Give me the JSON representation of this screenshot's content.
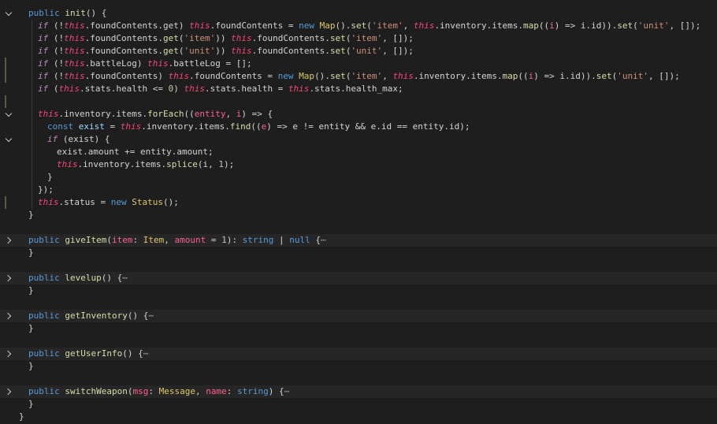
{
  "editor": {
    "lines": [
      {
        "indent": 0,
        "tokens": [
          [
            "kw",
            "public"
          ],
          [
            "op",
            " "
          ],
          [
            "fn",
            "init"
          ],
          [
            "op",
            "() {"
          ]
        ]
      },
      {
        "indent": 1,
        "tokens": [
          [
            "ctl",
            "if"
          ],
          [
            "op",
            " (!"
          ],
          [
            "th",
            "this"
          ],
          [
            "op",
            ".foundContents.get) "
          ],
          [
            "th",
            "this"
          ],
          [
            "op",
            ".foundContents = "
          ],
          [
            "kw",
            "new"
          ],
          [
            "op",
            " "
          ],
          [
            "cls",
            "Map"
          ],
          [
            "op",
            "()."
          ],
          [
            "fn",
            "set"
          ],
          [
            "op",
            "("
          ],
          [
            "str",
            "'item'"
          ],
          [
            "op",
            ", "
          ],
          [
            "th",
            "this"
          ],
          [
            "op",
            ".inventory.items."
          ],
          [
            "fn",
            "map"
          ],
          [
            "op",
            "(("
          ],
          [
            "prm",
            "i"
          ],
          [
            "op",
            ") => i.id))."
          ],
          [
            "fn",
            "set"
          ],
          [
            "op",
            "("
          ],
          [
            "str",
            "'unit'"
          ],
          [
            "op",
            ", []);"
          ]
        ]
      },
      {
        "indent": 1,
        "tokens": [
          [
            "ctl",
            "if"
          ],
          [
            "op",
            " (!"
          ],
          [
            "th",
            "this"
          ],
          [
            "op",
            ".foundContents."
          ],
          [
            "fn",
            "get"
          ],
          [
            "op",
            "("
          ],
          [
            "str",
            "'item'"
          ],
          [
            "op",
            ")) "
          ],
          [
            "th",
            "this"
          ],
          [
            "op",
            ".foundContents."
          ],
          [
            "fn",
            "set"
          ],
          [
            "op",
            "("
          ],
          [
            "str",
            "'item'"
          ],
          [
            "op",
            ", []);"
          ]
        ]
      },
      {
        "indent": 1,
        "tokens": [
          [
            "ctl",
            "if"
          ],
          [
            "op",
            " (!"
          ],
          [
            "th",
            "this"
          ],
          [
            "op",
            ".foundContents."
          ],
          [
            "fn",
            "get"
          ],
          [
            "op",
            "("
          ],
          [
            "str",
            "'unit'"
          ],
          [
            "op",
            ")) "
          ],
          [
            "th",
            "this"
          ],
          [
            "op",
            ".foundContents."
          ],
          [
            "fn",
            "set"
          ],
          [
            "op",
            "("
          ],
          [
            "str",
            "'unit'"
          ],
          [
            "op",
            ", []);"
          ]
        ]
      },
      {
        "indent": 1,
        "tokens": [
          [
            "ctl",
            "if"
          ],
          [
            "op",
            " (!"
          ],
          [
            "th",
            "this"
          ],
          [
            "op",
            ".battleLog) "
          ],
          [
            "th",
            "this"
          ],
          [
            "op",
            ".battleLog = [];"
          ]
        ]
      },
      {
        "indent": 1,
        "tokens": [
          [
            "ctl",
            "if"
          ],
          [
            "op",
            " (!"
          ],
          [
            "th",
            "this"
          ],
          [
            "op",
            ".foundContents) "
          ],
          [
            "th",
            "this"
          ],
          [
            "op",
            ".foundContents = "
          ],
          [
            "kw",
            "new"
          ],
          [
            "op",
            " "
          ],
          [
            "cls",
            "Map"
          ],
          [
            "op",
            "()."
          ],
          [
            "fn",
            "set"
          ],
          [
            "op",
            "("
          ],
          [
            "str",
            "'item'"
          ],
          [
            "op",
            ", "
          ],
          [
            "th",
            "this"
          ],
          [
            "op",
            ".inventory.items."
          ],
          [
            "fn",
            "map"
          ],
          [
            "op",
            "(("
          ],
          [
            "prm",
            "i"
          ],
          [
            "op",
            ") => i.id))."
          ],
          [
            "fn",
            "set"
          ],
          [
            "op",
            "("
          ],
          [
            "str",
            "'unit'"
          ],
          [
            "op",
            ", []);"
          ]
        ]
      },
      {
        "indent": 1,
        "tokens": [
          [
            "ctl",
            "if"
          ],
          [
            "op",
            " ("
          ],
          [
            "th",
            "this"
          ],
          [
            "op",
            ".stats.health <= "
          ],
          [
            "num",
            "0"
          ],
          [
            "op",
            ") "
          ],
          [
            "th",
            "this"
          ],
          [
            "op",
            ".stats.health = "
          ],
          [
            "th",
            "this"
          ],
          [
            "op",
            ".stats.health_max;"
          ]
        ]
      },
      {
        "indent": 1,
        "tokens": []
      },
      {
        "indent": 1,
        "tokens": [
          [
            "th",
            "this"
          ],
          [
            "op",
            ".inventory.items."
          ],
          [
            "fn",
            "forEach"
          ],
          [
            "op",
            "(("
          ],
          [
            "prm",
            "entity"
          ],
          [
            "op",
            ", "
          ],
          [
            "prm",
            "i"
          ],
          [
            "op",
            ") => {"
          ]
        ]
      },
      {
        "indent": 2,
        "tokens": [
          [
            "kw",
            "const"
          ],
          [
            "op",
            " "
          ],
          [
            "prop",
            "exist"
          ],
          [
            "op",
            " = "
          ],
          [
            "th",
            "this"
          ],
          [
            "op",
            ".inventory.items."
          ],
          [
            "fn",
            "find"
          ],
          [
            "op",
            "(("
          ],
          [
            "prm",
            "e"
          ],
          [
            "op",
            ") => e != entity && e.id == entity.id);"
          ]
        ]
      },
      {
        "indent": 2,
        "tokens": [
          [
            "ctl",
            "if"
          ],
          [
            "op",
            " (exist) {"
          ]
        ]
      },
      {
        "indent": 3,
        "tokens": [
          [
            "op",
            "exist.amount += entity.amount;"
          ]
        ]
      },
      {
        "indent": 3,
        "tokens": [
          [
            "th",
            "this"
          ],
          [
            "op",
            ".inventory.items."
          ],
          [
            "fn",
            "splice"
          ],
          [
            "op",
            "(i, "
          ],
          [
            "num",
            "1"
          ],
          [
            "op",
            ");"
          ]
        ]
      },
      {
        "indent": 2,
        "tokens": [
          [
            "op",
            "}"
          ]
        ]
      },
      {
        "indent": 1,
        "tokens": [
          [
            "op",
            "});"
          ]
        ]
      },
      {
        "indent": 1,
        "tokens": [
          [
            "th",
            "this"
          ],
          [
            "op",
            ".status = "
          ],
          [
            "kw",
            "new"
          ],
          [
            "op",
            " "
          ],
          [
            "cls",
            "Status"
          ],
          [
            "op",
            "();"
          ]
        ]
      },
      {
        "indent": 0,
        "tokens": [
          [
            "op",
            "}"
          ]
        ]
      },
      {
        "indent": 0,
        "tokens": []
      },
      {
        "indent": 0,
        "folded": true,
        "tokens": [
          [
            "kw",
            "public"
          ],
          [
            "op",
            " "
          ],
          [
            "fn",
            "giveItem"
          ],
          [
            "op",
            "("
          ],
          [
            "prm",
            "item"
          ],
          [
            "op",
            ": "
          ],
          [
            "cls",
            "Item"
          ],
          [
            "op",
            ", "
          ],
          [
            "prm",
            "amount"
          ],
          [
            "op",
            " = "
          ],
          [
            "num",
            "1"
          ],
          [
            "op",
            "): "
          ],
          [
            "kw",
            "string"
          ],
          [
            "op",
            " | "
          ],
          [
            "kw",
            "null"
          ],
          [
            "op",
            " {"
          ],
          [
            "ell",
            "⋯"
          ]
        ]
      },
      {
        "indent": 0,
        "tokens": [
          [
            "op",
            "}"
          ]
        ]
      },
      {
        "indent": 0,
        "tokens": []
      },
      {
        "indent": 0,
        "folded": true,
        "tokens": [
          [
            "kw",
            "public"
          ],
          [
            "op",
            " "
          ],
          [
            "fn",
            "levelup"
          ],
          [
            "op",
            "() {"
          ],
          [
            "ell",
            "⋯"
          ]
        ]
      },
      {
        "indent": 0,
        "tokens": [
          [
            "op",
            "}"
          ]
        ]
      },
      {
        "indent": 0,
        "tokens": []
      },
      {
        "indent": 0,
        "folded": true,
        "tokens": [
          [
            "kw",
            "public"
          ],
          [
            "op",
            " "
          ],
          [
            "fn",
            "getInventory"
          ],
          [
            "op",
            "() {"
          ],
          [
            "ell",
            "⋯"
          ]
        ]
      },
      {
        "indent": 0,
        "tokens": [
          [
            "op",
            "}"
          ]
        ]
      },
      {
        "indent": 0,
        "tokens": []
      },
      {
        "indent": 0,
        "folded": true,
        "tokens": [
          [
            "kw",
            "public"
          ],
          [
            "op",
            " "
          ],
          [
            "fn",
            "getUserInfo"
          ],
          [
            "op",
            "() {"
          ],
          [
            "ell",
            "⋯"
          ]
        ]
      },
      {
        "indent": 0,
        "tokens": [
          [
            "op",
            "}"
          ]
        ]
      },
      {
        "indent": 0,
        "tokens": []
      },
      {
        "indent": 0,
        "folded": true,
        "tokens": [
          [
            "kw",
            "public"
          ],
          [
            "op",
            " "
          ],
          [
            "fn",
            "switchWeapon"
          ],
          [
            "op",
            "("
          ],
          [
            "prm",
            "msg"
          ],
          [
            "op",
            ": "
          ],
          [
            "cls",
            "Message"
          ],
          [
            "op",
            ", "
          ],
          [
            "prm",
            "name"
          ],
          [
            "op",
            ": "
          ],
          [
            "kw",
            "string"
          ],
          [
            "op",
            ") {"
          ],
          [
            "ell",
            "⋯"
          ]
        ]
      },
      {
        "indent": 0,
        "tokens": [
          [
            "op",
            "}"
          ]
        ]
      },
      {
        "indent": -1,
        "tokens": [
          [
            "op",
            "}"
          ]
        ]
      }
    ],
    "fold_open_lines": [
      0,
      8,
      10
    ],
    "fold_closed_lines": [
      18,
      21,
      24,
      27,
      30
    ],
    "modified_lines": [
      4,
      5,
      7,
      15
    ]
  }
}
